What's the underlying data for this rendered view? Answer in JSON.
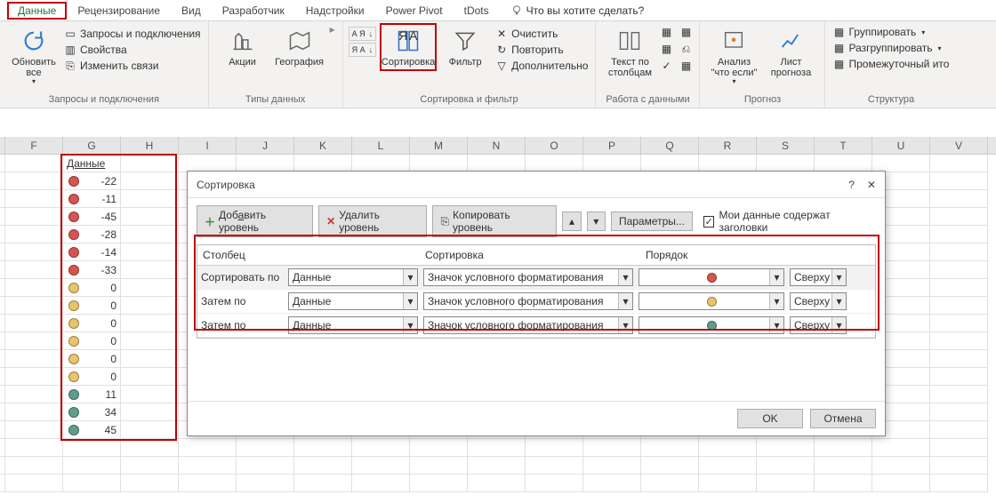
{
  "tabs": {
    "items": [
      "Данные",
      "Рецензирование",
      "Вид",
      "Разработчик",
      "Надстройки",
      "Power Pivot",
      "tDots"
    ],
    "tell_me": "Что вы хотите сделать?"
  },
  "ribbon": {
    "g1": {
      "refresh": "Обновить все",
      "q": "Запросы и подключения",
      "p": "Свойства",
      "l": "Изменить связи",
      "label": "Запросы и подключения"
    },
    "g2": {
      "a": "Акции",
      "b": "География",
      "label": "Типы данных"
    },
    "g3": {
      "sort": "Сортировка",
      "filter": "Фильтр",
      "clear": "Очистить",
      "reapply": "Повторить",
      "adv": "Дополнительно",
      "label": "Сортировка и фильтр",
      "az": "А Я",
      "za": "Я А"
    },
    "g4": {
      "t": "Текст по столбцам",
      "label": "Работа с данными"
    },
    "g5": {
      "w": "Анализ \"что если\"",
      "f": "Лист прогноза",
      "label": "Прогноз"
    },
    "g6": {
      "a": "Группировать",
      "b": "Разгруппировать",
      "c": "Промежуточный ито",
      "label": "Структура"
    }
  },
  "cols": [
    "F",
    "G",
    "H",
    "I",
    "J",
    "K",
    "L",
    "M",
    "N",
    "O",
    "P",
    "Q",
    "R",
    "S",
    "T",
    "U",
    "V"
  ],
  "data": {
    "header": "Данные",
    "rows": [
      {
        "c": "#d9534f",
        "v": "-22"
      },
      {
        "c": "#d9534f",
        "v": "-11"
      },
      {
        "c": "#d9534f",
        "v": "-45"
      },
      {
        "c": "#d9534f",
        "v": "-28"
      },
      {
        "c": "#d9534f",
        "v": "-14"
      },
      {
        "c": "#d9534f",
        "v": "-33"
      },
      {
        "c": "#e9c46a",
        "v": "0"
      },
      {
        "c": "#e9c46a",
        "v": "0"
      },
      {
        "c": "#e9c46a",
        "v": "0"
      },
      {
        "c": "#e9c46a",
        "v": "0"
      },
      {
        "c": "#e9c46a",
        "v": "0"
      },
      {
        "c": "#e9c46a",
        "v": "0"
      },
      {
        "c": "#5f9e8f",
        "v": "11"
      },
      {
        "c": "#5f9e8f",
        "v": "34"
      },
      {
        "c": "#5f9e8f",
        "v": "45"
      }
    ]
  },
  "dialog": {
    "title": "Сортировка",
    "add": "Добавить уровень",
    "del": "Удалить уровень",
    "copy": "Копировать уровень",
    "params": "Параметры...",
    "my_data": "Мои данные содержат заголовки",
    "col_h": "Столбец",
    "sort_h": "Сортировка",
    "order_h": "Порядок",
    "sort_by": "Сортировать по",
    "then_by": "Затем по",
    "col_val": "Данные",
    "sort_val": "Значок условного форматирования",
    "pos": "Сверху",
    "ok": "OK",
    "cancel": "Отмена",
    "levels": [
      {
        "label": "Сортировать по",
        "c": "#d9534f"
      },
      {
        "label": "Затем по",
        "c": "#e9c46a"
      },
      {
        "label": "Затем по",
        "c": "#5f9e8f"
      }
    ]
  }
}
